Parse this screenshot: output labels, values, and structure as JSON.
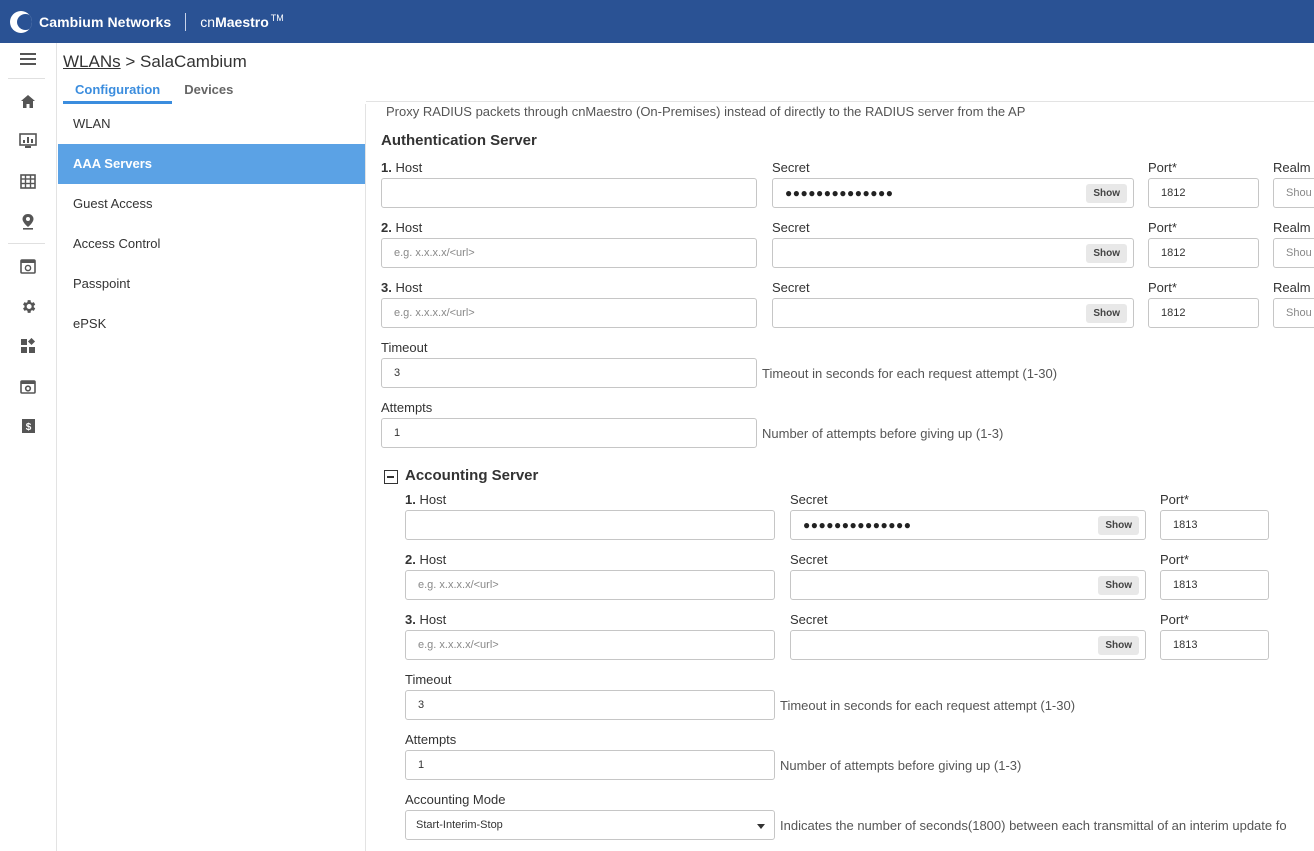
{
  "header": {
    "brand": "Cambium Networks",
    "product_prefix": "cn",
    "product_name": "Maestro",
    "product_tm": "TM"
  },
  "rail": {
    "icons": [
      "menu-icon",
      "home-icon",
      "dashboard-icon",
      "table-icon",
      "location-pin-icon",
      "monitor-icon",
      "gear-icon",
      "apps-icon",
      "calendar-settings-icon",
      "dollar-icon"
    ]
  },
  "breadcrumb": {
    "parent": "WLANs",
    "separator": ">",
    "current": "SalaCambium"
  },
  "tabs": [
    {
      "label": "Configuration",
      "active": true
    },
    {
      "label": "Devices",
      "active": false
    }
  ],
  "subnav": [
    {
      "label": "WLAN"
    },
    {
      "label": "AAA Servers",
      "active": true
    },
    {
      "label": "Guest Access"
    },
    {
      "label": "Access Control"
    },
    {
      "label": "Passpoint"
    },
    {
      "label": "ePSK"
    }
  ],
  "proxy_note": "Proxy RADIUS packets through cnMaestro (On-Premises) instead of directly to the RADIUS server from the AP",
  "auth": {
    "title": "Authentication Server",
    "host_label": "Host",
    "secret_label": "Secret",
    "port_label": "Port*",
    "realm_label": "Realm",
    "show_label": "Show",
    "host_placeholder": "e.g. x.x.x.x/<url>",
    "realm_placeholder": "Shou",
    "rows": [
      {
        "num": "1.",
        "host": "",
        "secret": "●●●●●●●●●●●●●●",
        "port": "1812"
      },
      {
        "num": "2.",
        "host": "",
        "secret": "",
        "port": "1812"
      },
      {
        "num": "3.",
        "host": "",
        "secret": "",
        "port": "1812"
      }
    ],
    "timeout_label": "Timeout",
    "timeout_value": "3",
    "timeout_help": "Timeout in seconds for each request attempt (1-30)",
    "attempts_label": "Attempts",
    "attempts_value": "1",
    "attempts_help": "Number of attempts before giving up (1-3)"
  },
  "acct": {
    "title": "Accounting Server",
    "rows": [
      {
        "num": "1.",
        "host": "",
        "secret": "●●●●●●●●●●●●●●",
        "port": "1813"
      },
      {
        "num": "2.",
        "host": "",
        "secret": "",
        "port": "1813"
      },
      {
        "num": "3.",
        "host": "",
        "secret": "",
        "port": "1813"
      }
    ],
    "timeout_label": "Timeout",
    "timeout_value": "3",
    "timeout_help": "Timeout in seconds for each request attempt (1-30)",
    "attempts_label": "Attempts",
    "attempts_value": "1",
    "attempts_help": "Number of attempts before giving up (1-3)",
    "mode_label": "Accounting Mode",
    "mode_value": "Start-Interim-Stop",
    "mode_help": "Indicates the number of seconds(1800) between each transmittal of an interim update fo"
  }
}
